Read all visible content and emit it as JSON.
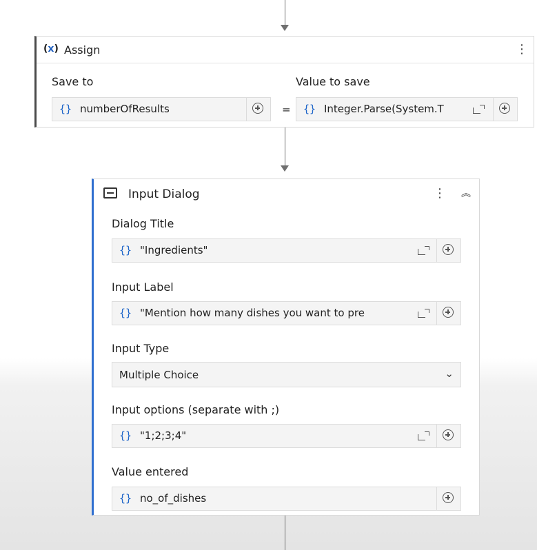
{
  "assign": {
    "title": "Assign",
    "save_to_label": "Save to",
    "value_label": "Value to save",
    "save_to_value": "numberOfResults",
    "value_to_save": "Integer.Parse(System.T",
    "equals": "=",
    "brace": "{}"
  },
  "input_dialog": {
    "title": "Input Dialog",
    "dialog_title_label": "Dialog Title",
    "dialog_title_value": "\"Ingredients\"",
    "input_label_label": "Input Label",
    "input_label_value": "\"Mention how many dishes you want to pre",
    "input_type_label": "Input Type",
    "input_type_value": "Multiple Choice",
    "input_options_label": "Input options (separate with ;)",
    "input_options_value": "\"1;2;3;4\"",
    "value_entered_label": "Value entered",
    "value_entered_value": "no_of_dishes",
    "brace": "{}"
  },
  "icons": {
    "assign": "variable-x-icon",
    "dialog": "window-icon",
    "more": "kebab-icon",
    "collapse": "double-chevron-up-icon",
    "add": "plus-circle-icon",
    "expand": "expand-editor-icon",
    "dropdown": "chevron-down-icon"
  },
  "colors": {
    "accent": "#2f6fd0",
    "brace": "#1f66c9"
  }
}
